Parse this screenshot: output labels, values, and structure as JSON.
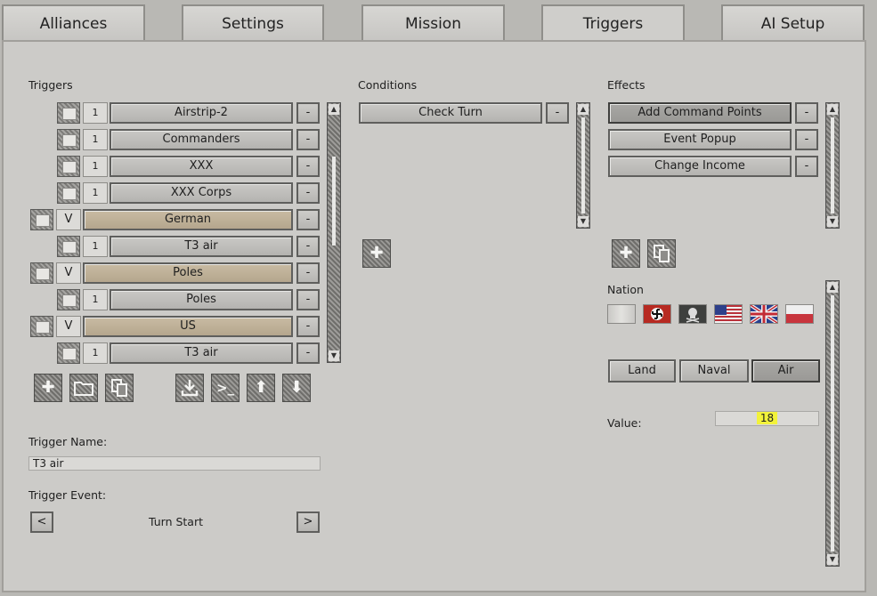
{
  "tabs": [
    {
      "label": "Alliances"
    },
    {
      "label": "Settings"
    },
    {
      "label": "Mission"
    },
    {
      "label": "Triggers"
    },
    {
      "label": "AI Setup"
    }
  ],
  "triggers": {
    "title": "Triggers",
    "rows": [
      {
        "badge": "1",
        "label": "Airstrip-2",
        "style": "grey",
        "indent": true
      },
      {
        "badge": "1",
        "label": "Commanders",
        "style": "grey",
        "indent": true
      },
      {
        "badge": "1",
        "label": "XXX",
        "style": "grey",
        "indent": true
      },
      {
        "badge": "1",
        "label": "XXX Corps",
        "style": "grey",
        "indent": true
      },
      {
        "badge": "V",
        "label": "German",
        "style": "tan",
        "indent": false
      },
      {
        "badge": "1",
        "label": "T3 air",
        "style": "grey",
        "indent": true
      },
      {
        "badge": "V",
        "label": "Poles",
        "style": "tan",
        "indent": false
      },
      {
        "badge": "1",
        "label": "Poles",
        "style": "grey",
        "indent": true
      },
      {
        "badge": "V",
        "label": "US",
        "style": "tan",
        "indent": false
      },
      {
        "badge": "1",
        "label": "T3 air",
        "style": "grey",
        "indent": true
      }
    ],
    "remove_label": "-",
    "trigger_name_label": "Trigger Name:",
    "trigger_name_value": "T3 air",
    "trigger_event_label": "Trigger Event:",
    "trigger_event_value": "Turn Start",
    "prev_label": "<",
    "next_label": ">"
  },
  "conditions": {
    "title": "Conditions",
    "items": [
      {
        "label": "Check Turn"
      }
    ]
  },
  "effects": {
    "title": "Effects",
    "items": [
      {
        "label": "Add Command Points",
        "selected": true
      },
      {
        "label": "Event Popup",
        "selected": false
      },
      {
        "label": "Change Income",
        "selected": false
      }
    ]
  },
  "nation": {
    "title": "Nation",
    "flags": [
      "neutral-flag",
      "german-flag",
      "skull-flag",
      "us-flag",
      "uk-flag",
      "poland-flag"
    ]
  },
  "domains": [
    "Land",
    "Naval",
    "Air"
  ],
  "value": {
    "label": "Value:",
    "amount": "18"
  },
  "colors": {
    "panel": "#cccbc8",
    "tan": "#c0b299",
    "highlight": "#f2f23a"
  }
}
